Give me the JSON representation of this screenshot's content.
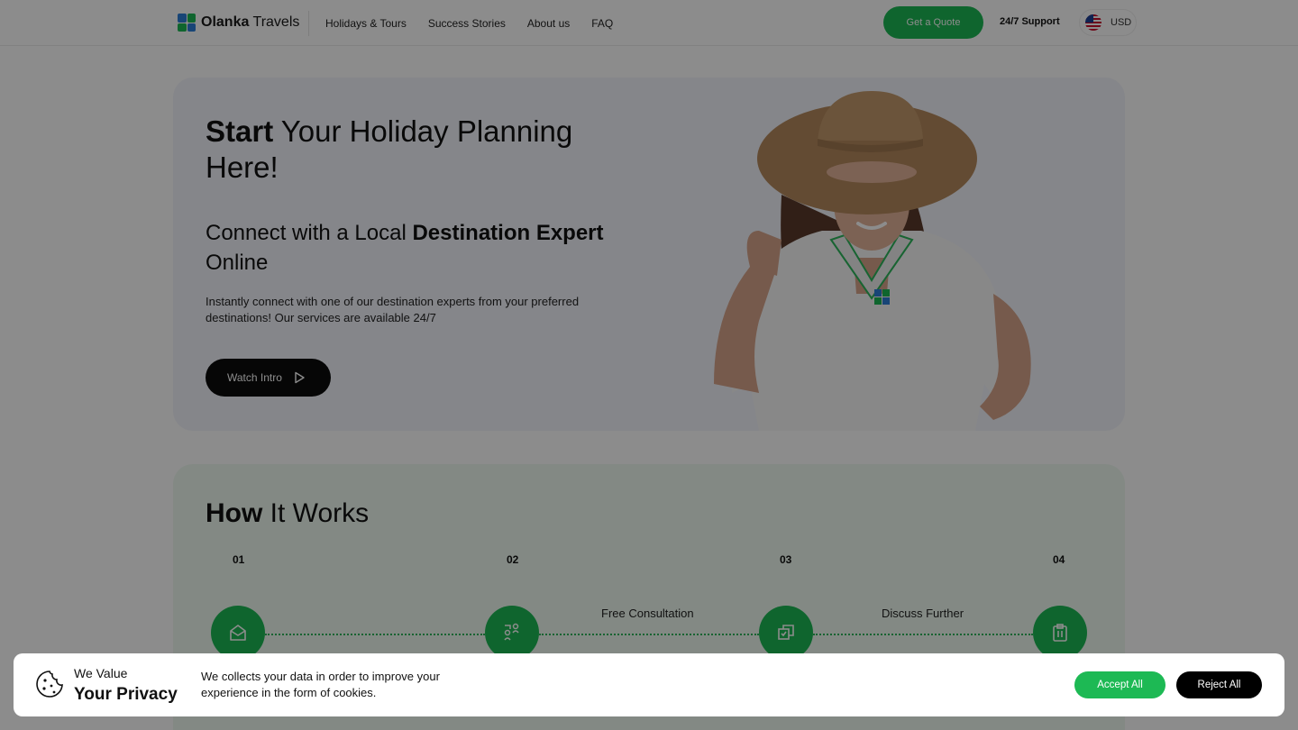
{
  "header": {
    "logo_bold": "Olanka",
    "logo_rest": " Travels",
    "nav": [
      "Holidays & Tours",
      "Success Stories",
      "About us",
      "FAQ"
    ],
    "quote_button": "Get a Quote",
    "support": "24/7 Support",
    "currency": "USD"
  },
  "hero": {
    "title_bold": "Start",
    "title_rest": " Your Holiday Planning Here!",
    "sub_pre": "Connect with a Local ",
    "sub_bold": "Destination Expert",
    "sub_post": " Online",
    "description": "Instantly connect with one of our destination experts from your preferred destinations! Our services are available 24/7",
    "watch_button": "Watch Intro"
  },
  "how": {
    "title_bold": "How",
    "title_rest": " It Works",
    "steps": [
      {
        "num": "01",
        "icon": "envelope-icon"
      },
      {
        "num": "02",
        "icon": "people-icon"
      },
      {
        "num": "03",
        "icon": "copy-check-icon"
      },
      {
        "num": "04",
        "icon": "clipboard-icon"
      }
    ],
    "labels": [
      "Free Consultation",
      "Discuss Further"
    ]
  },
  "cookie": {
    "heading_line1": "We Value",
    "heading_line2": "Your Privacy",
    "text": "We collects your data in order to improve your experience in the form of cookies.",
    "accept": "Accept All",
    "reject": "Reject All"
  },
  "colors": {
    "accent": "#1db954",
    "dark_button": "#0b0b0b",
    "hero_bg": "#f3f5fc",
    "how_bg": "#eefaf1"
  }
}
